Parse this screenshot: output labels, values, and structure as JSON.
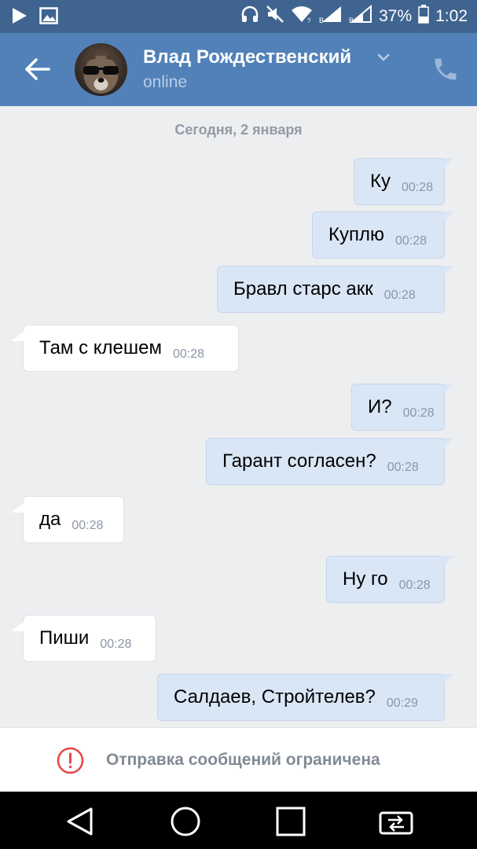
{
  "status_bar": {
    "battery": "37%",
    "time": "1:02",
    "icons": [
      "play-icon",
      "image-icon",
      "headphones-icon",
      "mute-icon",
      "wifi-icon",
      "signal-icon",
      "signal-icon",
      "battery-icon"
    ]
  },
  "header": {
    "contact_name": "Влад Рождественский",
    "status": "online",
    "back_icon": "arrow-left-icon",
    "call_icon": "phone-icon",
    "colors": {
      "bar": "#5181b8",
      "status_bar": "#3f6490"
    }
  },
  "chat": {
    "date_separator": "Сегодня, 2 января",
    "messages": [
      {
        "text": "Ку",
        "time": "00:28",
        "direction": "out"
      },
      {
        "text": "Куплю",
        "time": "00:28",
        "direction": "out"
      },
      {
        "text": "Бравл старс акк",
        "time": "00:28",
        "direction": "out"
      },
      {
        "text": "Там с клешем",
        "time": "00:28",
        "direction": "in"
      },
      {
        "text": "И?",
        "time": "00:28",
        "direction": "out"
      },
      {
        "text": "Гарант согласен?",
        "time": "00:28",
        "direction": "out"
      },
      {
        "text": "да",
        "time": "00:28",
        "direction": "in"
      },
      {
        "text": "Ну го",
        "time": "00:28",
        "direction": "out"
      },
      {
        "text": "Пиши",
        "time": "00:28",
        "direction": "in"
      },
      {
        "text": "Салдаев, Стройтелев?",
        "time": "00:29",
        "direction": "out"
      }
    ]
  },
  "footer": {
    "restricted_text": "Отправка сообщений ограничена",
    "warning_color": "#e64646"
  },
  "nav_bar": {
    "buttons": [
      "back-triangle-icon",
      "home-circle-icon",
      "recents-square-icon",
      "screen-switch-icon"
    ]
  }
}
